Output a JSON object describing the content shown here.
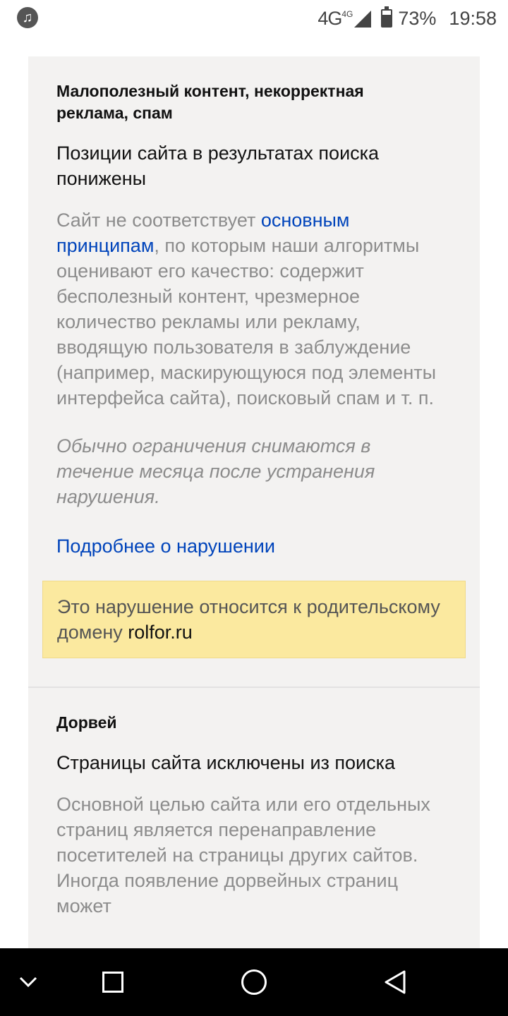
{
  "status_bar": {
    "icon_left": "music-note-icon",
    "network": "4G",
    "network_sup": "4G",
    "battery_level_pct": 73,
    "battery_text": "73%",
    "time": "19:58"
  },
  "violation_1": {
    "category": "Малополезный контент, некорректная реклама, спам",
    "status": "Позиции сайта в результатах поиска понижены",
    "desc_before": "Сайт не соответствует ",
    "desc_link": "основным принципам",
    "desc_after": ", по которым наши алгоритмы оценивают его качество: содержит бесполезный контент, чрезмерное количество рекламы или рекламу, вводящую пользователя в заблуждение (например, маскирующуюся под элементы интерфейса сайта), поисковый спам и т. п.",
    "note": "Обычно ограничения снимаются в течение месяца после устранения нарушения.",
    "more_link": "Подробнее о нарушении",
    "notice_text": "Это нарушение относится к родительскому домену ",
    "notice_domain": "rolfor.ru"
  },
  "violation_2": {
    "category": "Дорвей",
    "status": "Страницы сайта исключены из поиска",
    "desc": "Основной целью сайта или его отдельных страниц является перенаправление посетителей на страницы других сайтов. Иногда появление дорвейных страниц может"
  },
  "nav_bar": {
    "buttons": [
      "chevron-down-icon",
      "recents-square-icon",
      "home-circle-icon",
      "back-triangle-icon"
    ]
  },
  "colors": {
    "card_bg": "#f3f2f1",
    "link": "#0044bb",
    "muted_text": "#8c8c8c",
    "notice_bg": "#fbe99f"
  }
}
